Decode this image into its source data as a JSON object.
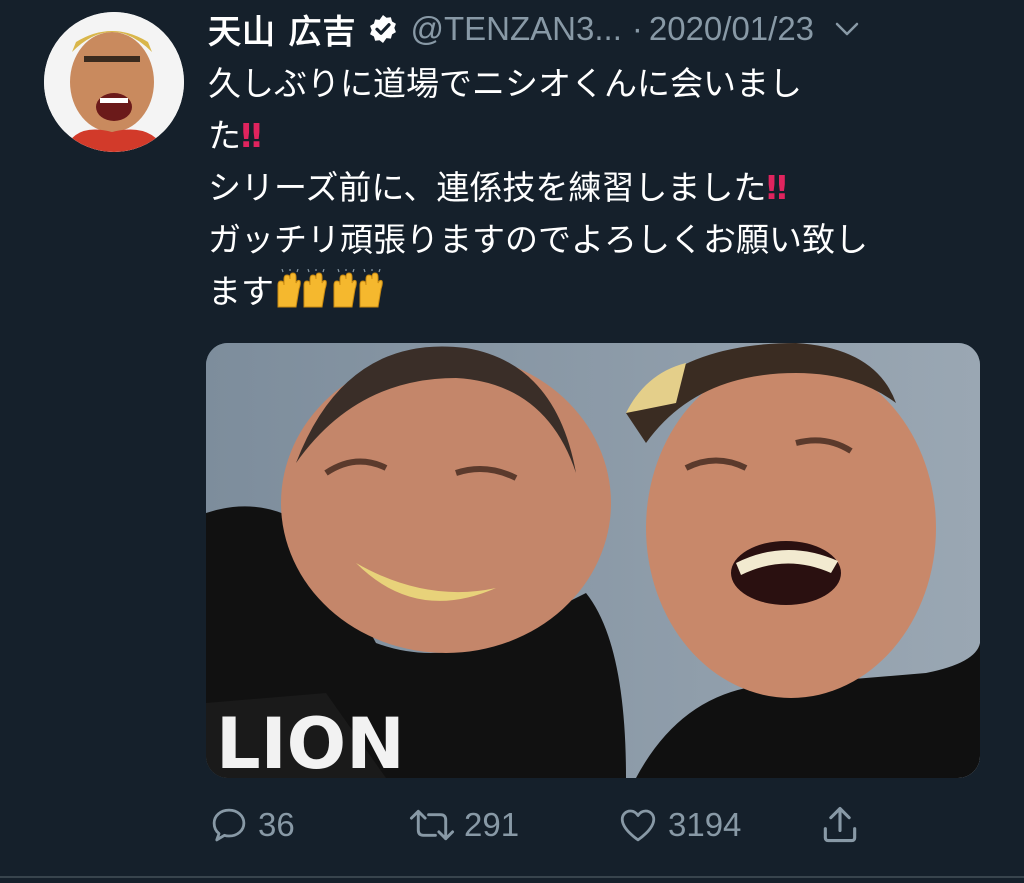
{
  "tweet": {
    "display_name": "天山 広吉",
    "handle": "@TENZAN3...",
    "separator": "·",
    "date": "2020/01/23",
    "verified_icon": "verified-badge-icon",
    "menu_icon": "chevron-down-icon",
    "text_lines": [
      "久しぶりに道場でニシオくんに会いまし",
      "た",
      "シリーズ前に、連係技を練習しました",
      "ガッチリ頑張りますのでよろしくお願い致し",
      "ます"
    ],
    "emoji": {
      "double_exclamation": "‼",
      "raising_hands": "raising-hands-emoji"
    }
  },
  "actions": {
    "reply_count": "36",
    "retweet_count": "291",
    "like_count": "3194",
    "reply_icon": "reply-icon",
    "retweet_icon": "retweet-icon",
    "like_icon": "heart-icon",
    "share_icon": "share-icon"
  },
  "colors": {
    "background": "#15202b",
    "text_primary": "#ffffff",
    "text_secondary": "#8899a6",
    "emoji_red": "#e0245e",
    "verified": "#ffffff"
  }
}
